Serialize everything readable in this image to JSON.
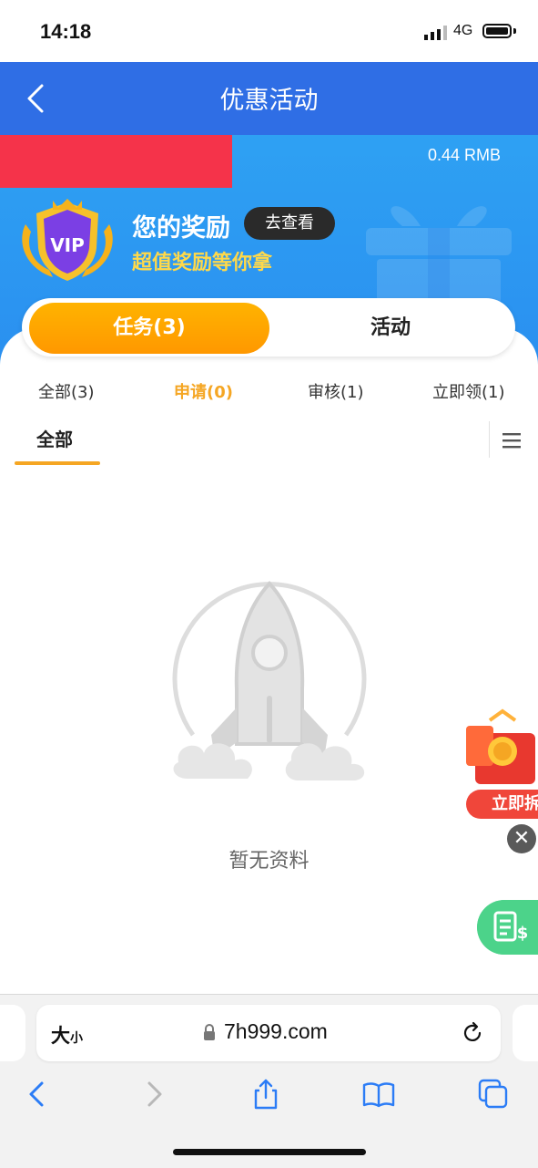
{
  "status_bar": {
    "time": "14:18",
    "network": "4G"
  },
  "header": {
    "title": "优惠活动"
  },
  "banner": {
    "balance": "0.44 RMB",
    "vip_badge": "VIP",
    "reward_title": "您的奖励",
    "view_button": "去查看",
    "reward_subtitle": "超值奖励等你拿"
  },
  "switch_tabs": [
    {
      "label": "任务(3)",
      "active": true
    },
    {
      "label": "活动",
      "active": false
    }
  ],
  "filters": [
    {
      "label": "全部(3)",
      "active": false
    },
    {
      "label": "申请(0)",
      "active": true
    },
    {
      "label": "审核(1)",
      "active": false
    },
    {
      "label": "立即领(1)",
      "active": false
    }
  ],
  "sub_tab": {
    "label": "全部"
  },
  "empty": {
    "text": "暂无资料"
  },
  "floating": {
    "promo_label": "立即拆",
    "close": "✕"
  },
  "browser": {
    "aa_big": "大",
    "aa_small": "小",
    "url": "7h999.com"
  },
  "colors": {
    "header": "#2f6ee5",
    "accent": "#f5a623",
    "red_bar": "#f5334a",
    "money_btn": "#4cd38a"
  }
}
